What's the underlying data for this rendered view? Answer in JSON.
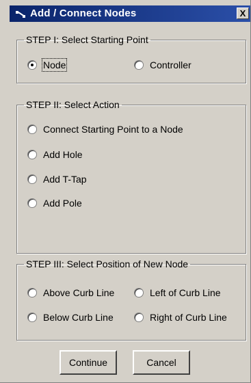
{
  "window": {
    "title": "Add / Connect Nodes",
    "close_label": "X"
  },
  "step1": {
    "legend": "STEP I: Select Starting  Point",
    "options": [
      {
        "label": "Node",
        "selected": true
      },
      {
        "label": "Controller",
        "selected": false
      }
    ]
  },
  "step2": {
    "legend": "STEP II: Select Action",
    "options": [
      {
        "label": "Connect Starting Point to a Node",
        "selected": false
      },
      {
        "label": "Add Hole",
        "selected": false
      },
      {
        "label": "Add T-Tap",
        "selected": false
      },
      {
        "label": "Add Pole",
        "selected": false
      }
    ]
  },
  "step3": {
    "legend": "STEP III: Select Position of New Node",
    "options": [
      {
        "label": "Above Curb Line",
        "selected": false
      },
      {
        "label": "Left of Curb Line",
        "selected": false
      },
      {
        "label": "Below Curb Line",
        "selected": false
      },
      {
        "label": "Right of Curb Line",
        "selected": false
      }
    ]
  },
  "buttons": {
    "continue_label": "Continue",
    "cancel_label": "Cancel"
  }
}
